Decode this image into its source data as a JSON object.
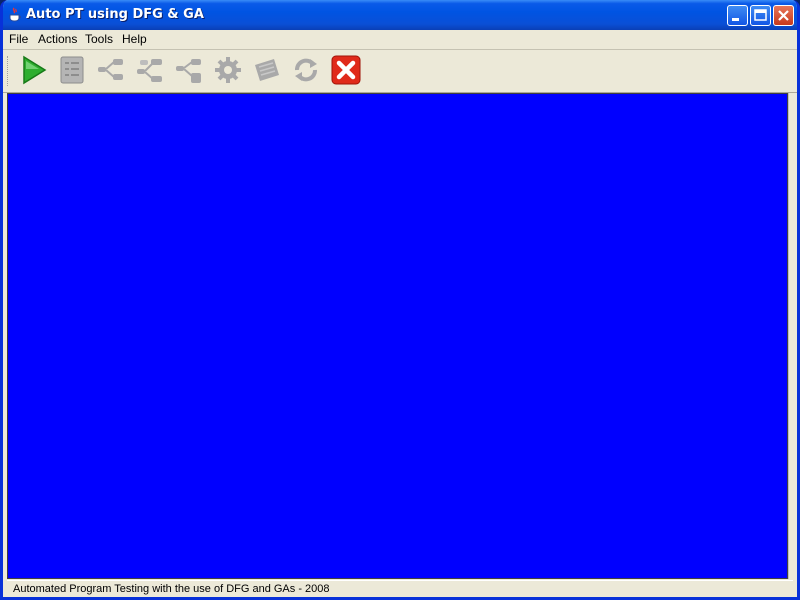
{
  "window": {
    "title": "Auto PT using DFG & GA"
  },
  "menu": {
    "items": [
      "File",
      "Actions",
      "Tools",
      "Help"
    ]
  },
  "toolbar": {
    "buttons": [
      {
        "icon": "play-icon",
        "enabled": true
      },
      {
        "icon": "document-list-icon",
        "enabled": false
      },
      {
        "icon": "flow-graph-icon",
        "enabled": false
      },
      {
        "icon": "multi-flow-graph-icon",
        "enabled": false
      },
      {
        "icon": "branch-graph-icon",
        "enabled": false
      },
      {
        "icon": "gear-icon",
        "enabled": false
      },
      {
        "icon": "notes-icon",
        "enabled": false
      },
      {
        "icon": "refresh-icon",
        "enabled": false
      },
      {
        "icon": "close-red-x-icon",
        "enabled": true
      }
    ]
  },
  "canvas": {
    "background": "#0000ff"
  },
  "status": {
    "text": "Automated Program Testing with the use of DFG and GAs - 2008"
  }
}
